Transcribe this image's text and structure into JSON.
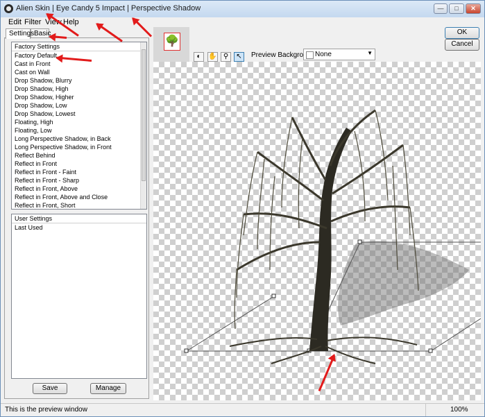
{
  "window": {
    "title": "Alien Skin | Eye Candy 5 Impact | Perspective Shadow"
  },
  "menu": {
    "items": [
      "Edit",
      "Filter",
      "View",
      "Help"
    ]
  },
  "tabs": {
    "settings": "Settings",
    "basic": "Basic"
  },
  "factory_settings": {
    "header": "Factory Settings",
    "items": [
      "Factory Default",
      "Cast in Front",
      "Cast on Wall",
      "Drop Shadow, Blurry",
      "Drop Shadow, High",
      "Drop Shadow, Higher",
      "Drop Shadow, Low",
      "Drop Shadow, Lowest",
      "Floating, High",
      "Floating, Low",
      "Long Perspective Shadow, in Back",
      "Long Perspective Shadow, in Front",
      "Reflect Behind",
      "Reflect in Front",
      "Reflect in Front - Faint",
      "Reflect in Front - Sharp",
      "Reflect in Front, Above",
      "Reflect in Front, Above and Close",
      "Reflect in Front, Short"
    ]
  },
  "user_settings": {
    "header": "User Settings",
    "items": [
      "Last Used"
    ]
  },
  "buttons": {
    "save": "Save",
    "manage": "Manage",
    "ok": "OK",
    "cancel": "Cancel"
  },
  "preview": {
    "background_label": "Preview Background:",
    "background_value": "None"
  },
  "status": {
    "message": "This is the preview window",
    "zoom": "100%"
  },
  "colors": {
    "annotation_arrow": "#e21b1b",
    "selection_border": "#3c7fb1"
  },
  "icons": [
    "app-icon",
    "minimize-icon",
    "maximize-icon",
    "close-icon",
    "compare-tool-icon",
    "hand-tool-icon",
    "zoom-tool-icon",
    "pointer-tool-icon",
    "dropdown-arrow-icon",
    "color-swatch-icon"
  ]
}
